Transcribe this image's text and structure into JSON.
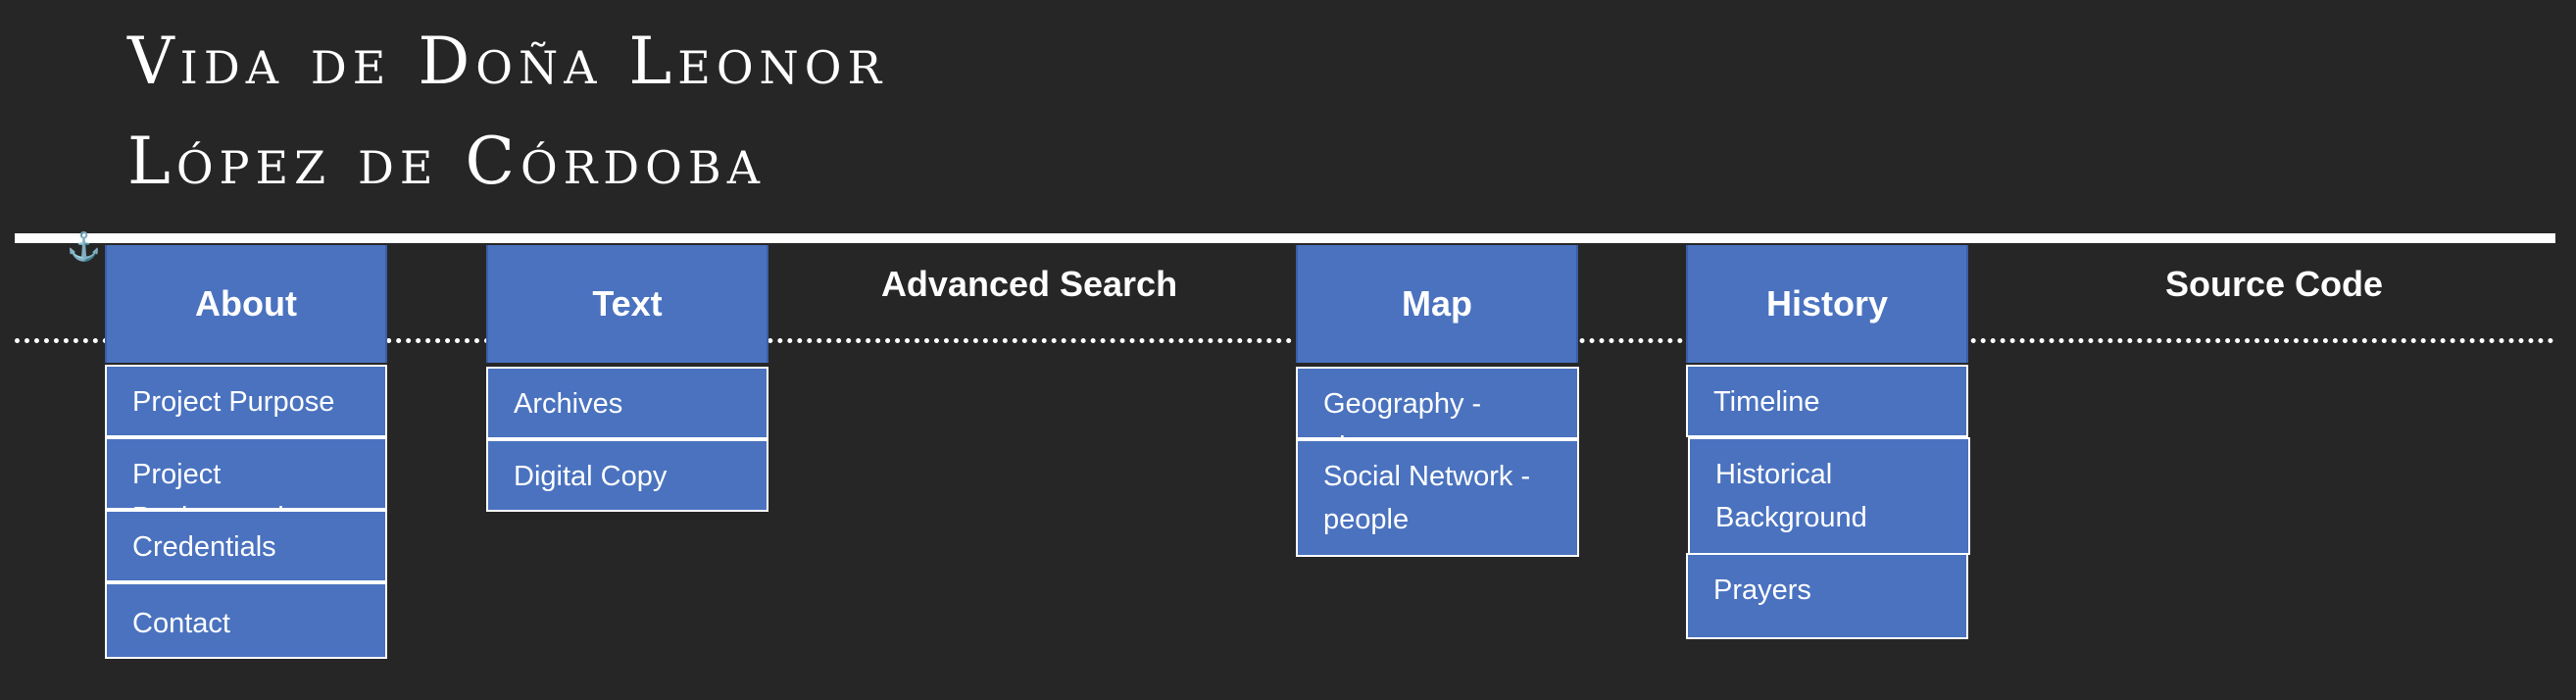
{
  "title": {
    "line1": "Vida de Doña Leonor",
    "line2": "López de Córdoba"
  },
  "icons": {
    "anchor": "⚓"
  },
  "colors": {
    "background": "#262626",
    "tab": "#4a72bf",
    "text": "#ffffff"
  },
  "nav": {
    "about": {
      "label": "About",
      "items": [
        "Project Purpose",
        "Project Background",
        "Credentials",
        "Contact"
      ]
    },
    "text": {
      "label": "Text",
      "items": [
        "Archives",
        "Digital Copy"
      ]
    },
    "advanced_search": {
      "label": "Advanced Search"
    },
    "map": {
      "label": "Map",
      "items": [
        "Geography - places",
        "Social Network - people"
      ]
    },
    "history": {
      "label": "History",
      "items": [
        "Timeline",
        "Historical Background",
        "Prayers"
      ]
    },
    "source_code": {
      "label": "Source Code"
    }
  }
}
